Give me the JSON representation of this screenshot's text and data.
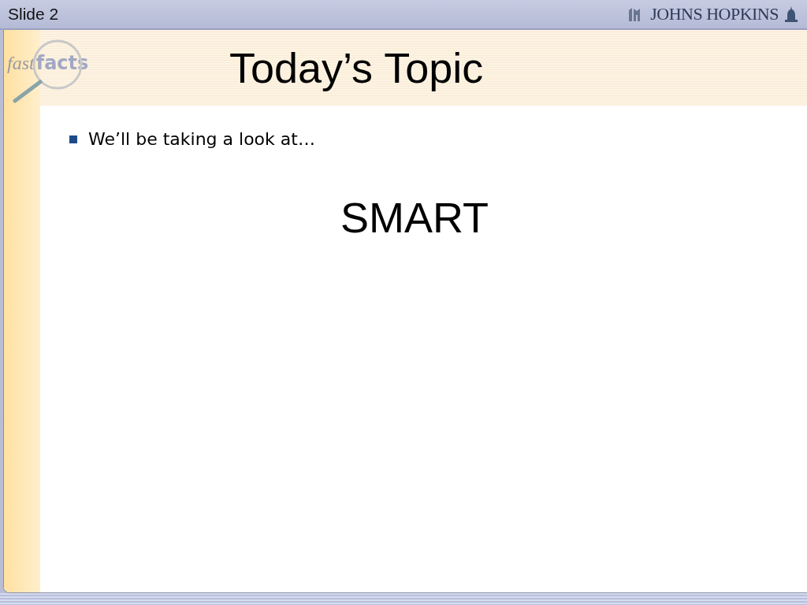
{
  "slide_label": "Slide 2",
  "header_logo": {
    "text": "JOHNS HOPKINS"
  },
  "corner_logo": {
    "word_1": "fast",
    "word_2": "facts"
  },
  "title": "Today’s Topic",
  "bullets": [
    "We’ll be taking a look at…"
  ],
  "emphasis": "SMART"
}
